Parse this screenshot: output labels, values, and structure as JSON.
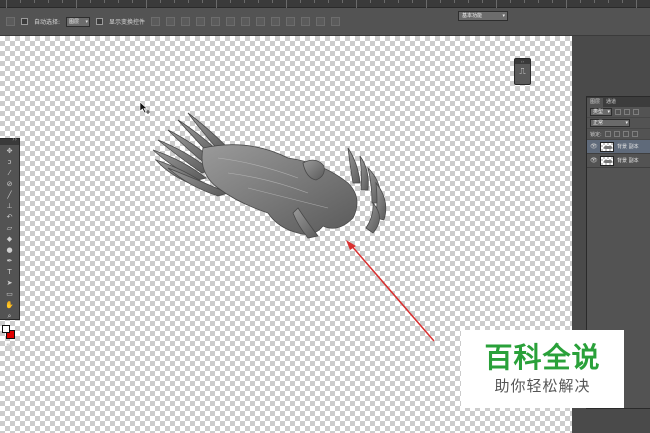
{
  "options_bar": {
    "auto_select_label": "自动选择:",
    "auto_select_value": "图层",
    "show_transform_label": "显示变换控件"
  },
  "workspace": {
    "value": "基本功能"
  },
  "layers_panel": {
    "tabs": [
      "图层",
      "通道"
    ],
    "filter_kind": "类型",
    "blend_mode": "正常",
    "lock_label": "锁定:",
    "layers": [
      {
        "name": "背景 副本"
      },
      {
        "name": "背景 副本"
      }
    ]
  },
  "watermark": {
    "title": "百科全说",
    "subtitle": "助你轻松解决"
  },
  "colors": {
    "foreground": "#ffffff",
    "background": "#e00000",
    "arrow": "#d93030",
    "watermark_green": "#2aa13a"
  }
}
